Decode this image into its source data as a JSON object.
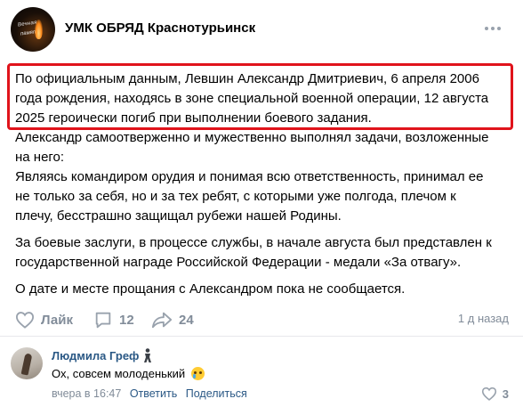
{
  "post": {
    "group_name": "УМК ОБРЯД Краснотурьинск",
    "group_avatar_icon": "candle-avatar-icon",
    "avatar_lettering": [
      "Вечная",
      "память!"
    ],
    "more_icon": "more-dots-icon",
    "highlight_color": "#e0131b",
    "highlight_lines": [
      "По официальным данным, Левшин Александр Дмитриевич, 6 апреля 2006",
      "года рождения, находясь в зоне специальной военной операции, 12 августа",
      "2025 героически погиб при выполнении боевого задания."
    ],
    "para2_lines": [
      "Александр самоотверженно и мужественно выполнял задачи, возложенные",
      "на него:",
      "Являясь командиром орудия и понимая всю ответственность, принимал ее",
      "не только за себя, но и за тех ребят, с которыми уже полгода, плечом к",
      "плечу, бесстрашно защищал рубежи нашей Родины."
    ],
    "para3_lines": [
      "За боевые заслуги, в процессе службы, в начале августа был представлен к",
      "государственной награде Российской Федерации - медали «За отвагу»."
    ],
    "para4_lines": [
      "О дате и месте прощания с Александром пока не сообщается."
    ],
    "actions": {
      "like_label": "Лайк",
      "like_icon": "heart-icon",
      "comment_count": "12",
      "comment_icon": "comment-icon",
      "share_count": "24",
      "share_icon": "share-arrow-icon",
      "time": "1 д назад"
    }
  },
  "comment": {
    "author": "Людмила Греф",
    "badge_icon": "figure-badge-icon",
    "text": "Ох, совсем молоденький",
    "emoji_icon": "crying-face-icon",
    "time": "вчера в 16:47",
    "reply_label": "Ответить",
    "share_label": "Поделиться",
    "like_icon": "heart-icon",
    "like_count": "3"
  },
  "colors": {
    "link": "#2a5885",
    "muted": "#818c99",
    "icon": "#99a2ad"
  }
}
